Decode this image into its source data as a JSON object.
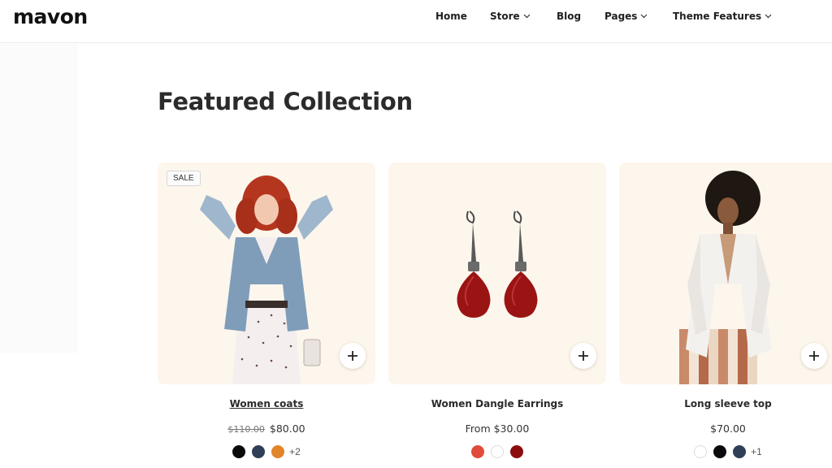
{
  "brand": {
    "logo_text": "mavon"
  },
  "nav": {
    "items": [
      {
        "label": "Home",
        "has_dropdown": false
      },
      {
        "label": "Store",
        "has_dropdown": true
      },
      {
        "label": "Blog",
        "has_dropdown": false
      },
      {
        "label": "Pages",
        "has_dropdown": true
      },
      {
        "label": "Theme Features",
        "has_dropdown": true
      }
    ]
  },
  "section": {
    "title": "Featured Collection"
  },
  "products": [
    {
      "title": "Women coats",
      "badge": "SALE",
      "old_price": "$110.00",
      "price": "$80.00",
      "swatches": [
        "#0a0a0a",
        "#2f3f57",
        "#e2852a"
      ],
      "more_swatches": "+2",
      "image": "woman-denim-jacket-photo"
    },
    {
      "title": "Women Dangle Earrings",
      "price": "From $30.00",
      "swatches": [
        "#e14b3b",
        "#ffffff",
        "#8a0c0c"
      ],
      "image": "red-dangle-earrings-photo"
    },
    {
      "title": "Long sleeve top",
      "price": "$70.00",
      "swatches": [
        "#ffffff",
        "#0a0a0a",
        "#2f3f57"
      ],
      "more_swatches": "+1",
      "image": "woman-white-shirt-photo"
    }
  ],
  "colors": {
    "card_background": "#fdf6ed",
    "text": "#2b2b2b"
  }
}
